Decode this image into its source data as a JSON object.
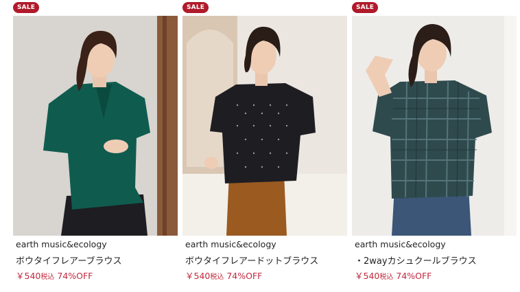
{
  "products": [
    {
      "badge": "SALE",
      "brand": "earth music&ecology",
      "name": "ボウタイフレアーブラウス",
      "price": "￥540",
      "tax_label": "税込",
      "discount": "74%OFF",
      "colors": {
        "bg": "#d9d6d2",
        "top": "#0f5c4f",
        "hair": "#3a2219"
      }
    },
    {
      "badge": "SALE",
      "brand": "earth music&ecology",
      "name": "ボウタイフレアードットブラウス",
      "price": "￥540",
      "tax_label": "税込",
      "discount": "74%OFF",
      "colors": {
        "bg": "#e8e2db",
        "top": "#1e1e22",
        "hair": "#2a1c16"
      }
    },
    {
      "badge": "SALE",
      "brand": "earth music&ecology",
      "name": "・2wayカシュクールブラウス",
      "price": "￥540",
      "tax_label": "税込",
      "discount": "74%OFF",
      "colors": {
        "bg": "#ecebe8",
        "top": "#2f4a4d",
        "hair": "#2b1d17"
      }
    }
  ],
  "theme": {
    "sale_badge": "#b01a2b",
    "price_color": "#c0283c"
  }
}
